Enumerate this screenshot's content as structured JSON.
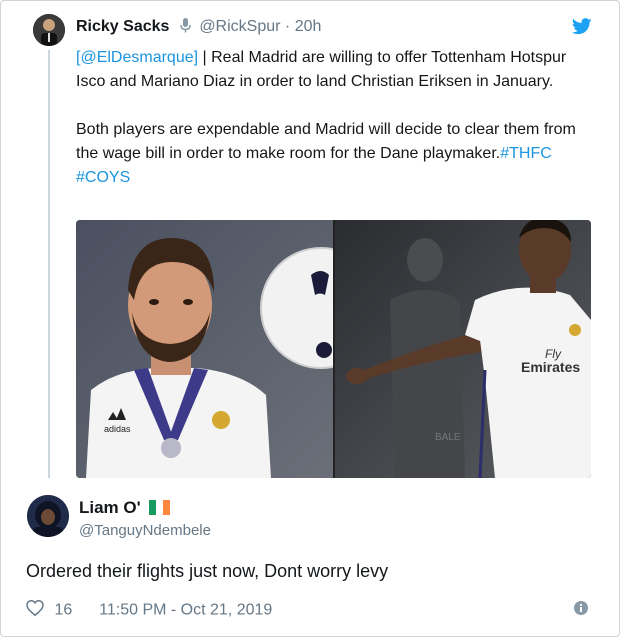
{
  "tweet": {
    "author_name": "Ricky Sacks",
    "handle": "@RickSpur",
    "separator": "·",
    "time": "20h",
    "text_paragraph_1_link": "[@ElDesmarque]",
    "text_paragraph_1": " | Real Madrid are willing to offer Tottenham Hotspur Isco and Mariano Diaz in order to land Christian Eriksen in January.",
    "text_paragraph_2": "Both players are expendable and Madrid will decide to clear them from the wage bill in order to make room for the Dane playmaker.",
    "hashtags": [
      "#THFC",
      "#COYS"
    ],
    "icons": {
      "mic": "microphone-icon",
      "logo": "twitter-bird-icon"
    },
    "image_text": {
      "kit_brand": "adidas",
      "shirt_sponsor_line1": "Fly",
      "shirt_sponsor_line2": "Emirates",
      "background_word": "BALE"
    }
  },
  "reply": {
    "author_name": "Liam O'",
    "handle": "@TanguyNdembele",
    "text": "Ordered their flights just now, Dont worry levy",
    "likes": "16",
    "timestamp": "11:50 PM - Oct 21, 2019",
    "flag": "ireland-flag-icon"
  },
  "colors": {
    "link": "#1b95e0",
    "secondary_text": "#657786",
    "primary_text": "#14171a",
    "twitter_blue": "#1da1f2"
  }
}
